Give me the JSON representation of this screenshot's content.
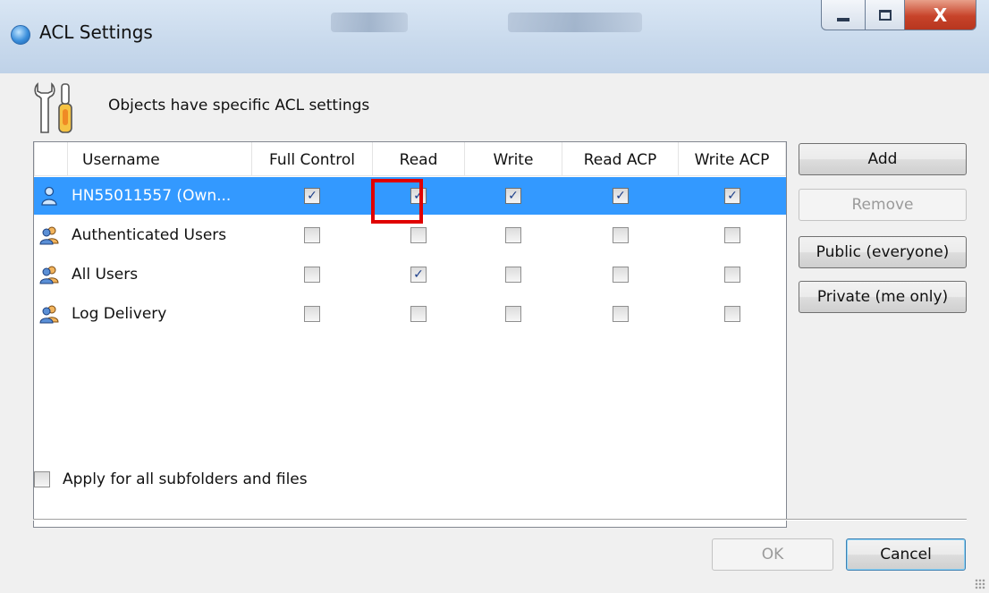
{
  "window": {
    "title": "ACL Settings",
    "close_glyph": "X"
  },
  "header": {
    "text": "Objects have specific ACL settings",
    "icon": "tools-icon"
  },
  "table": {
    "columns": [
      "Username",
      "Full Control",
      "Read",
      "Write",
      "Read ACP",
      "Write ACP"
    ],
    "rows": [
      {
        "name": "HN55011557 (Own...",
        "icon": "owner-user-icon",
        "selected": true,
        "checks": [
          true,
          true,
          true,
          true,
          true
        ]
      },
      {
        "name": "Authenticated Users",
        "icon": "group-users-icon",
        "selected": false,
        "checks": [
          false,
          false,
          false,
          false,
          false
        ]
      },
      {
        "name": "All Users",
        "icon": "group-users-icon",
        "selected": false,
        "checks": [
          false,
          true,
          false,
          false,
          false
        ]
      },
      {
        "name": "Log Delivery",
        "icon": "group-users-icon",
        "selected": false,
        "checks": [
          false,
          false,
          false,
          false,
          false
        ]
      }
    ],
    "highlight_color": "#e00000"
  },
  "side_buttons": {
    "add": "Add",
    "remove": "Remove",
    "public": "Public (everyone)",
    "private": "Private (me only)"
  },
  "apply": {
    "label": "Apply for all subfolders and files",
    "checked": false
  },
  "footer": {
    "ok": "OK",
    "cancel": "Cancel"
  },
  "colors": {
    "selection": "#3399ff",
    "titlebar": "#c8d9ec",
    "close_button": "#c7432a"
  }
}
